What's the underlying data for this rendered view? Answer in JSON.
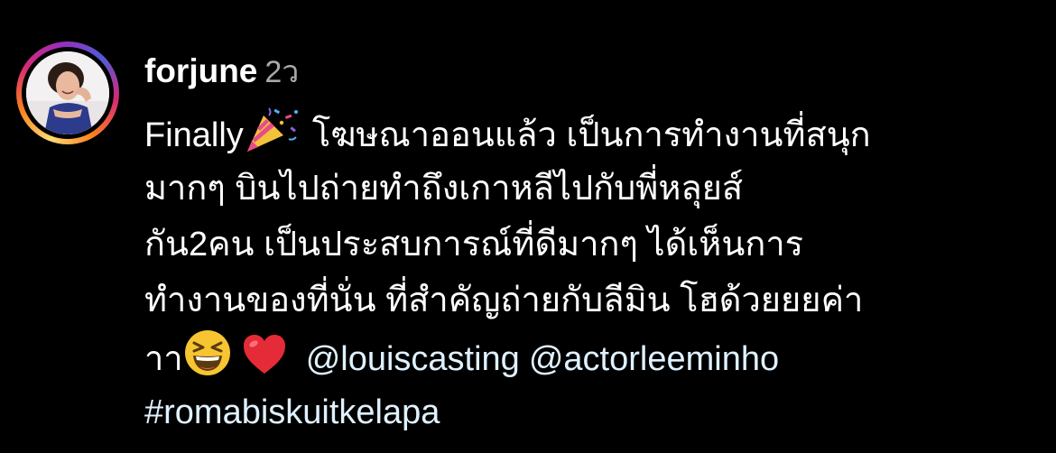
{
  "comment": {
    "username": "forjune",
    "timestamp": "2ว",
    "lines": {
      "l1_a": "Finally",
      "l1_b": "โฆษณาออนแล้ว เป็นการทำงานที่สนุก",
      "l2": "มากๆ บินไปถ่ายทำถึงเกาหลีไปกับพี่หลุยส์",
      "l3": "กัน2คน เป็นประสบการณ์ที่ดีมากๆ ได้เห็นการ",
      "l4": "ทำงานของที่นั่น ที่สำคัญถ่ายกับลีมิน โฮด้วยยยค่า",
      "l5_a": "าา"
    },
    "mentions": [
      "@louiscasting",
      "@actorleeminho"
    ],
    "hashtag": "#romabiskuitkelapa",
    "emojis": [
      "party-popper-icon",
      "grinning-squinting-face-icon",
      "red-heart-icon"
    ]
  },
  "colors": {
    "background": "#000000",
    "text": "#ffffff",
    "muted": "#a8a8a8",
    "link": "#e0f1ff"
  }
}
